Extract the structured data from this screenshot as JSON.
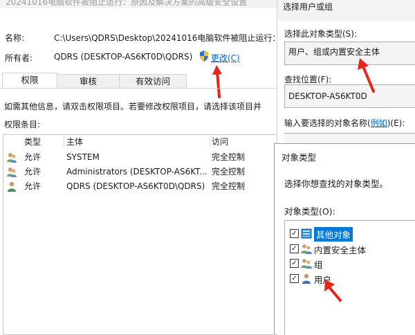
{
  "window_title": "20241016电脑软件被阻止运行：原因及解决方案的高级安全设置",
  "name_label": "名称:",
  "name_value": "C:\\Users\\QDRS\\Desktop\\20241016电脑软件被阻止运行：",
  "owner_label": "所有者:",
  "owner_value": "QDRS (DESKTOP-AS6KT0D\\QDRS)",
  "change_link": "更改(C)",
  "tabs": [
    "权限",
    "审核",
    "有效访问"
  ],
  "info_text": "如需其他信息，请双击权限项目。若要修改权限项目，请选择该项目并",
  "perm_entries_label": "权限条目:",
  "columns": {
    "type": "类型",
    "principal": "主体",
    "access": "访问"
  },
  "rows": [
    {
      "type": "允许",
      "principal": "SYSTEM",
      "access": "完全控制"
    },
    {
      "type": "允许",
      "principal": "Administrators (DESKTOP-AS6KT...",
      "access": "完全控制"
    },
    {
      "type": "允许",
      "principal": "QDRS (DESKTOP-AS6KT0D\\QDRS)",
      "access": "完全控制"
    }
  ],
  "select_dialog": {
    "title": "选择用户或组",
    "object_type_label": "选择此对象类型(S):",
    "object_type_value": "用户、组或内置安全主体",
    "location_label": "查找位置(F):",
    "location_value": "DESKTOP-AS6KT0D",
    "enter_name_prefix": "输入要选择的对象名称(",
    "enter_name_link": "例如",
    "enter_name_suffix": ")(E):"
  },
  "object_dialog": {
    "title": "对象类型",
    "prompt": "选择你想查找的对象类型。",
    "list_label": "对象类型(O):",
    "items": [
      {
        "label": "其他对象",
        "checked": true,
        "selected": true,
        "icon": "other-objects-icon"
      },
      {
        "label": "内置安全主体",
        "checked": true,
        "selected": false,
        "icon": "builtin-principal-icon"
      },
      {
        "label": "组",
        "checked": true,
        "selected": false,
        "icon": "group-icon"
      },
      {
        "label": "用户",
        "checked": true,
        "selected": false,
        "icon": "user-icon"
      }
    ]
  },
  "colors": {
    "accent": "#0a64c8",
    "arrow": "#e8231a",
    "selection": "#0078d7"
  }
}
